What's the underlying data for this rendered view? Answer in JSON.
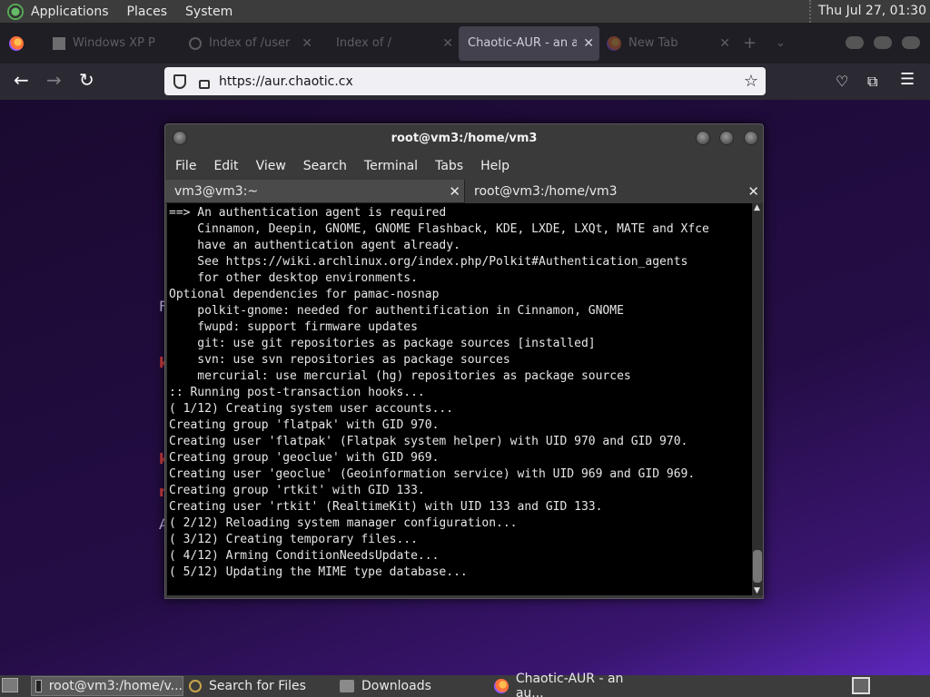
{
  "top_panel": {
    "menus": [
      "Applications",
      "Places",
      "System"
    ],
    "clock": "Thu Jul 27, 01:30"
  },
  "browser": {
    "tabs": [
      {
        "title": "Windows XP P",
        "active": false
      },
      {
        "title": "Index of /user",
        "active": false
      },
      {
        "title": "Index of /",
        "active": false
      },
      {
        "title": "Chaotic-AUR - an au",
        "active": true
      },
      {
        "title": "New Tab",
        "active": false
      }
    ],
    "new_tab": "+",
    "url": "https://aur.chaotic.cx",
    "nav": {
      "back": "←",
      "forward": "→",
      "reload": "↻"
    },
    "page_fragments": [
      "F",
      "k",
      "k",
      "r",
      "A"
    ]
  },
  "terminal": {
    "title": "root@vm3:/home/vm3",
    "menu": [
      "File",
      "Edit",
      "View",
      "Search",
      "Terminal",
      "Tabs",
      "Help"
    ],
    "tabs": [
      {
        "label": "vm3@vm3:~",
        "active": false
      },
      {
        "label": "root@vm3:/home/vm3",
        "active": true
      }
    ],
    "lines": [
      "==> An authentication agent is required",
      "    Cinnamon, Deepin, GNOME, GNOME Flashback, KDE, LXDE, LXQt, MATE and Xfce",
      "    have an authentication agent already.",
      "    See https://wiki.archlinux.org/index.php/Polkit#Authentication_agents",
      "    for other desktop environments.",
      "Optional dependencies for pamac-nosnap",
      "    polkit-gnome: needed for authentification in Cinnamon, GNOME",
      "    fwupd: support firmware updates",
      "    git: use git repositories as package sources [installed]",
      "    svn: use svn repositories as package sources",
      "    mercurial: use mercurial (hg) repositories as package sources",
      ":: Running post-transaction hooks...",
      "( 1/12) Creating system user accounts...",
      "Creating group 'flatpak' with GID 970.",
      "Creating user 'flatpak' (Flatpak system helper) with UID 970 and GID 970.",
      "Creating group 'geoclue' with GID 969.",
      "Creating user 'geoclue' (Geoinformation service) with UID 969 and GID 969.",
      "Creating group 'rtkit' with GID 133.",
      "Creating user 'rtkit' (RealtimeKit) with UID 133 and GID 133.",
      "( 2/12) Reloading system manager configuration...",
      "( 3/12) Creating temporary files...",
      "( 4/12) Arming ConditionNeedsUpdate...",
      "( 5/12) Updating the MIME type database..."
    ]
  },
  "taskbar": {
    "items": [
      {
        "label": "root@vm3:/home/v...",
        "icon": "terminal-icon",
        "active": true
      },
      {
        "label": "Search for Files",
        "icon": "search-icon",
        "active": false
      },
      {
        "label": "Downloads",
        "icon": "folder-icon",
        "active": false
      },
      {
        "label": "Chaotic-AUR - an au...",
        "icon": "firefox-icon",
        "active": false
      }
    ]
  }
}
